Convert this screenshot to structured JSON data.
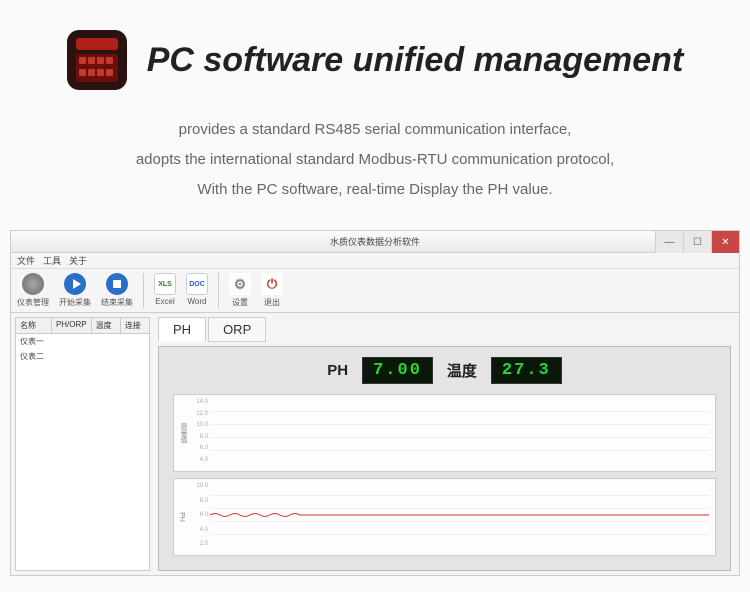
{
  "header": {
    "title": "PC software unified management",
    "desc_line1": "provides a standard RS485 serial communication interface,",
    "desc_line2": "adopts the international standard Modbus-RTU communication protocol,",
    "desc_line3": "With the PC software, real-time Display the PH value."
  },
  "window": {
    "title": "水质仪表数据分析软件",
    "menubar": [
      "文件",
      "工具",
      "关于"
    ],
    "toolbar": {
      "mgmt": "仪表管理",
      "start": "开始采集",
      "stop": "结束采集",
      "excel": "Excel",
      "word": "Word",
      "settings": "设置",
      "exit": "退出"
    },
    "sidebar": {
      "headers": [
        "名称",
        "PH/ORP",
        "温度",
        "连接"
      ],
      "rows": [
        "仪表一",
        "仪表二"
      ]
    },
    "tabs": {
      "ph": "PH",
      "orp": "ORP"
    },
    "readouts": {
      "ph_label": "PH",
      "ph_value": "7.00",
      "temp_label": "温度",
      "temp_value": "27.3"
    },
    "chart_data": [
      {
        "type": "line",
        "title": "",
        "ylabel": "测量值",
        "yticks": [
          "14.0",
          "12.0",
          "10.0",
          "8.0",
          "6.0",
          "4.0"
        ],
        "ylim": [
          4.0,
          14.0
        ],
        "series": [
          {
            "name": "PH",
            "values": []
          }
        ]
      },
      {
        "type": "line",
        "title": "",
        "ylabel": "PH",
        "yticks": [
          "10.0",
          "8.0",
          "6.0",
          "4.0",
          "2.0"
        ],
        "ylim": [
          2.0,
          10.0
        ],
        "series": [
          {
            "name": "PH",
            "values": [
              7.0,
              7.1,
              6.9,
              7.0,
              7.1,
              6.9,
              7.0,
              7.0,
              7.0,
              7.0,
              7.0
            ]
          }
        ]
      }
    ]
  }
}
